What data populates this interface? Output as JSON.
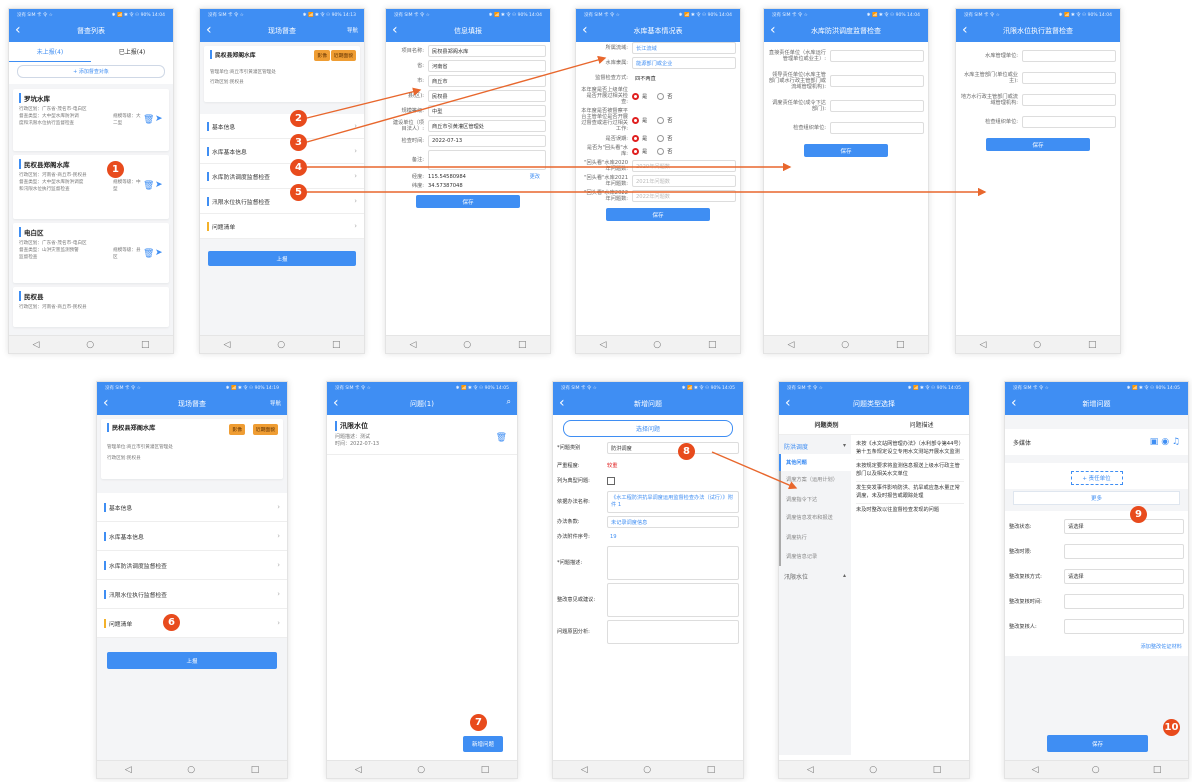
{
  "status_bar": {
    "p1": "没有 SIM 卡 令 ☆",
    "p2": "✱ 📶 ✱ 令 ⚇ 90% 14:04",
    "p2b": "✱ 📶 ✱ 令 ⚇ 90% 14:13",
    "p2c": "✱ 📶 ✱ 令 ⚇ 90% 14:19",
    "p2d": "✱ 📶 ✱ 令 ⚇ 90% 14:05"
  },
  "nav_glyphs": {
    "back": "◁",
    "home": "○",
    "recent": "□"
  },
  "s1": {
    "title": "督查列表",
    "tab_left": "未上报(4)",
    "tab_right": "已上报(4)",
    "add_btn": "+ 添加督查对象",
    "items": [
      {
        "name": "罗坑水库",
        "l1": "行政区划：广东省-茂名市-电白区",
        "l2": "督查类型：大中型水库防洪调",
        "l3": "度和汛限水位执行监督检查",
        "tag": "规模等级：大二型"
      },
      {
        "name": "民权县郑阁水库",
        "l1": "行政区划：河南省-商丘市-民权县",
        "l2": "督查类型：大中型水库防洪调度",
        "l3": "和汛限水位执行监督检查",
        "tag": "规模等级：中型"
      },
      {
        "name": "电白区",
        "l1": "行政区划：广东省-茂名市-电白区",
        "l2": "督查类型：山洪灾害监测预警",
        "l3": "监督检查",
        "tag": "规模等级：县区"
      },
      {
        "name": "民权县",
        "l1": "行政区划：河南省-商丘市-民权县",
        "l2": "",
        "l3": "",
        "tag": ""
      }
    ]
  },
  "s2": {
    "title": "现场督查",
    "nav": "导航",
    "reservoir": "民权县郑阁水库",
    "btn_img": "影像",
    "btn_near": "近期面貌",
    "mgmt": "管理单位:商丘市引黄灌区管理处",
    "area": "行政区划:民权县",
    "rows": [
      "基本信息",
      "水库基本信息",
      "水库防洪调度监督检查",
      "汛限水位执行监督检查",
      "问题清单"
    ],
    "report": "上报"
  },
  "s3": {
    "title": "信息填报",
    "fields": [
      {
        "k": "项目名称:",
        "v": "民权县郑阁水库"
      },
      {
        "k": "省:",
        "v": "河南省"
      },
      {
        "k": "市:",
        "v": "商丘市"
      },
      {
        "k": "县(区):",
        "v": "民权县"
      },
      {
        "k": "规模等级:",
        "v": "中型"
      },
      {
        "k": "建设单位（项目法人）:",
        "v": "商丘市引黄灌区管理处"
      },
      {
        "k": "检查时间:",
        "v": "2022-07-13"
      },
      {
        "k": "备注:",
        "v": ""
      }
    ],
    "lng_k": "经度:",
    "lng": "115.54580984",
    "lat_k": "纬度:",
    "lat": "34.57387048",
    "edit": "更改",
    "save": "保存"
  },
  "s4": {
    "title": "水库基本情况表",
    "basin_k": "所属流域:",
    "basin": "长江流域",
    "dept_k": "水库隶属:",
    "dept": "能源部门或企业",
    "method_k": "监督检查方式:",
    "method": "四不两直",
    "q": [
      "本年度是否上级单位是否开展过相关检查:",
      "本年度是否被督察平台主管单位是否开展过督查或进行过相关工作:",
      "是否误期:",
      "是否为\"回头看\"水库:"
    ],
    "yes": "是",
    "no": "否",
    "y2020_k": "\"回头看\"水库2020年问题数:",
    "y2020": "2020年问题数",
    "y2021_k": "\"回头看\"水库2021年问题数:",
    "y2021": "2021年问题数",
    "y2022_k": "\"回头看\"水库2022年问题数:",
    "y2022": "2022年问题数",
    "save": "保存"
  },
  "s5": {
    "title": "水库防洪调度监督检查",
    "f1": "直接责任单位（水库运行管理单位或业主）:",
    "f2": "领导责任单位(水库主管部门或水行政主管部门或流域管理机构):",
    "f3": "调度责任单位(成令下达部门):",
    "f4": "检查组织单位:",
    "save": "保存"
  },
  "s6": {
    "title": "汛限水位执行监督检查",
    "f1": "水库管理单位:",
    "f2": "水库主管部门(单位或业主):",
    "f3": "地方水行政主管部门或流域管理机构:",
    "f4": "检查组织单位:",
    "save": "保存"
  },
  "s8": {
    "title": "问题(1)",
    "item_title": "汛限水位",
    "desc": "问题描述：测试",
    "time": "时间：2022-07-13",
    "new_btn": "新增问题"
  },
  "s9": {
    "title": "新增问题",
    "select_btn": "选择问题",
    "cat_k": "*问题类别",
    "cat": "防洪调度",
    "sev_k": "严重程度:",
    "sev": "较重",
    "typical_k": "列为典型问题:",
    "law_k": "依据办法名称:",
    "law": "《水工程防洪抗旱调度运用监督检查办法（试行）》附件 1",
    "clause_k": "办法条款:",
    "clause": "未记录调度信息",
    "annex_k": "办法附件序号:",
    "annex": "19",
    "desc_k": "*问题描述:",
    "advice_k": "整改意见或建议:",
    "cause_k": "问题原因分析:"
  },
  "s10": {
    "title": "问题类型选择",
    "tab_cat": "问题类别",
    "tab_desc": "问题描述",
    "group1": "防洪调度",
    "cats": [
      "其他问题",
      "调度方案（运用计划）",
      "调度指令下达",
      "调度信息发布和报送",
      "调度执行",
      "调度信息记录"
    ],
    "group2": "汛限水位",
    "descs": [
      "未按《水文站网管理办法》（水利部令第44号）第十五条规定设立专用水文测站开展水文监测",
      "未按规定要求将监测信息报送上级水行政主管部门以及相关水文单位",
      "发生突发事件影响防洪、抗旱或应急水量正常调度，未及时报告或跟踪处理",
      "未及时整改以往监督检查发现的问题"
    ]
  },
  "s11": {
    "title": "新增问题",
    "media": "多媒体",
    "resp": "+ 责任单位",
    "more": "更多",
    "state_k": "整改状态:",
    "state": "请选择",
    "deadline_k": "整改时限:",
    "method_k": "整改复核方式:",
    "method": "请选择",
    "rtime_k": "整改复核时间:",
    "person_k": "整改复核人:",
    "evidence": "添加整改佐证材料",
    "save": "保存"
  },
  "badges": [
    "1",
    "2",
    "3",
    "4",
    "5",
    "6",
    "7",
    "8",
    "9",
    "10"
  ],
  "colors": {
    "primary": "#3f8ef3",
    "badge": "#e84b1d",
    "radio_on": "#e02020",
    "orange": "#ef9d33"
  }
}
